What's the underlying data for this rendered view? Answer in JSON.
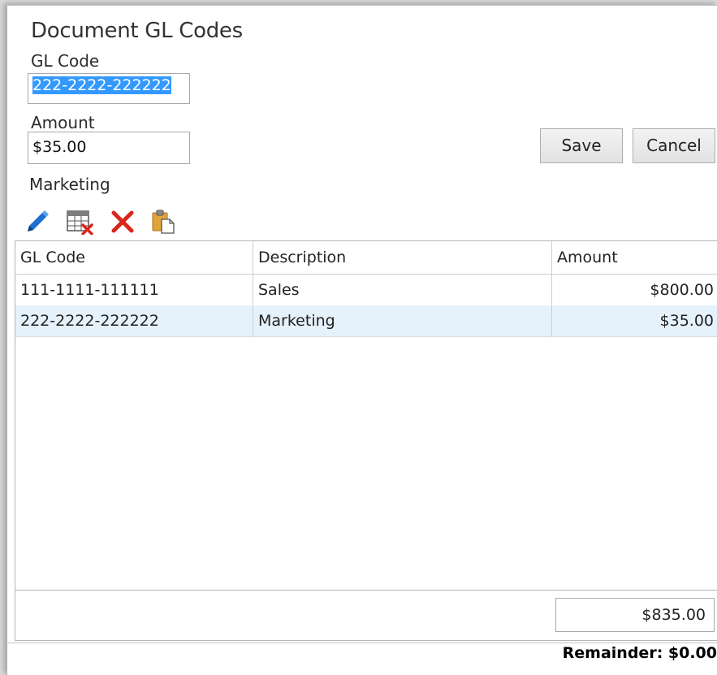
{
  "dialog": {
    "title": "Document GL Codes"
  },
  "form": {
    "gl_code_label": "GL Code",
    "gl_code_value": "222-2222-222222",
    "amount_label": "Amount",
    "amount_value": "$35.00",
    "description_text": "Marketing",
    "save_label": "Save",
    "cancel_label": "Cancel"
  },
  "toolbar": {
    "icons": [
      "edit-pencil-icon",
      "delete-row-grid-icon",
      "delete-x-icon",
      "paste-clipboard-icon"
    ]
  },
  "grid": {
    "columns": [
      "GL Code",
      "Description",
      "Amount"
    ],
    "rows": [
      {
        "gl_code": "111-1111-111111",
        "description": "Sales",
        "amount": "$800.00"
      },
      {
        "gl_code": "222-2222-222222",
        "description": "Marketing",
        "amount": "$35.00"
      }
    ],
    "total": "$835.00",
    "selected_row": 1
  },
  "footer": {
    "remainder": "Remainder: $0.00"
  },
  "colors": {
    "selection": "#3399ff",
    "selected_row": "#e5f1fb",
    "delete_red": "#d9261c",
    "pencil_blue": "#1e6fd1"
  }
}
